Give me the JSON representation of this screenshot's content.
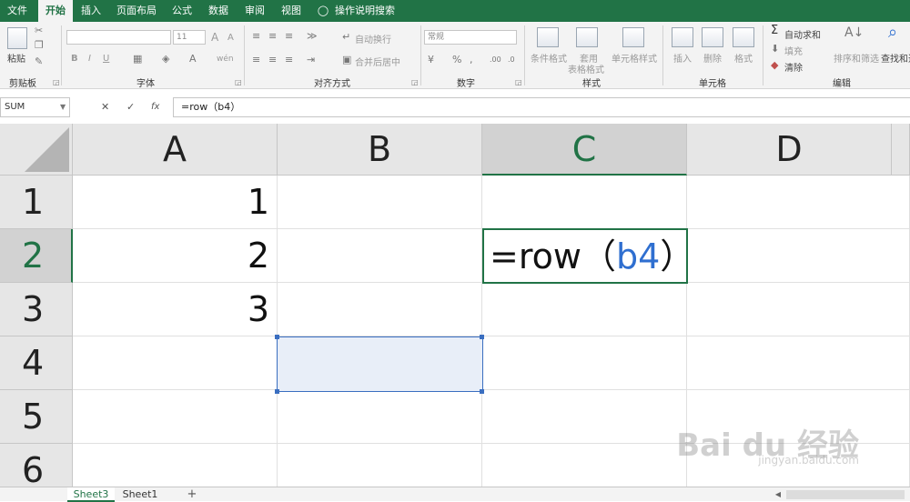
{
  "menu": {
    "file": "文件",
    "home": "开始",
    "insert": "插入",
    "page_layout": "页面布局",
    "formulas": "公式",
    "data": "数据",
    "review": "审阅",
    "view": "视图",
    "tell_me": "操作说明搜索"
  },
  "ribbon": {
    "clipboard": {
      "paste": "粘贴",
      "group": "剪贴板"
    },
    "font": {
      "size": "11",
      "bold": "B",
      "italic": "I",
      "underline": "U",
      "grow": "A",
      "shrink": "A",
      "wen": "wén",
      "group": "字体"
    },
    "alignment": {
      "wrap": "自动换行",
      "merge": "合并后居中",
      "group": "对齐方式"
    },
    "number": {
      "format": "常规",
      "group": "数字"
    },
    "styles": {
      "conditional": "条件格式",
      "table_fmt": "套用",
      "table_fmt2": "表格格式",
      "cell_styles": "单元格样式",
      "group": "样式"
    },
    "cells": {
      "insert": "插入",
      "delete": "删除",
      "format": "格式",
      "group": "单元格"
    },
    "editing": {
      "autosum": "自动求和",
      "fill": "填充",
      "clear": "清除",
      "sort": "排序和筛选",
      "find": "查找和选",
      "group": "编辑"
    }
  },
  "formula_bar": {
    "name_box": "SUM",
    "cancel": "✕",
    "enter": "✓",
    "fx": "fx",
    "formula": "=row（b4）"
  },
  "columns": [
    "A",
    "B",
    "C",
    "D"
  ],
  "rows": [
    "1",
    "2",
    "3",
    "4",
    "5",
    "6"
  ],
  "cells": {
    "A1": "1",
    "A2": "2",
    "A3": "3",
    "C2_prefix": "=row（",
    "C2_ref": "b4",
    "C2_suffix": "）"
  },
  "sheets": [
    "Sheet3",
    "Sheet1"
  ],
  "add_sheet": "+",
  "watermark": {
    "main": "Bai du 经验",
    "sub": "jingyan.baidu.com"
  },
  "colors": {
    "excel_green": "#217346",
    "ref_blue": "#2f6fd0"
  }
}
